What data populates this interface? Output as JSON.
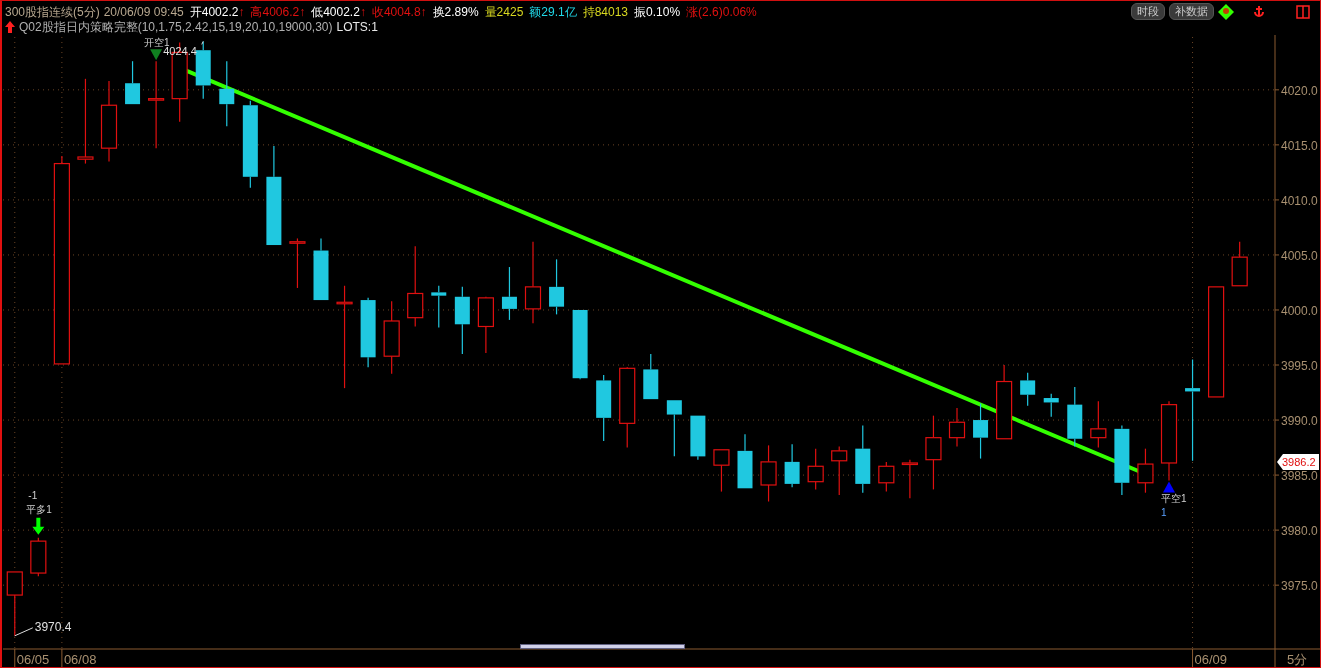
{
  "header": {
    "title": "300股指连续(5分)",
    "datetime": "20/06/09 09:45",
    "quotes": [
      {
        "label": "开",
        "value": "4002.2",
        "arrow": "↑",
        "color": "#ffffff"
      },
      {
        "label": "高",
        "value": "4006.2",
        "arrow": "↑",
        "color": "#e01010"
      },
      {
        "label": "低",
        "value": "4002.2",
        "arrow": "↑",
        "color": "#ffffff"
      },
      {
        "label": "收",
        "value": "4004.8",
        "arrow": "↑",
        "color": "#e01010"
      },
      {
        "label": "换",
        "value": "2.89%",
        "color": "#ffffff"
      },
      {
        "label": "量",
        "value": "2425",
        "color": "#d8d820"
      },
      {
        "label": "额",
        "value": "29.1亿",
        "color": "#20d8e8"
      },
      {
        "label": "持",
        "value": "84013",
        "color": "#d8d820"
      },
      {
        "label": "振",
        "value": "0.10%",
        "color": "#ffffff"
      },
      {
        "label": "涨",
        "value": "(2.6)0.06%",
        "color": "#e01010"
      }
    ],
    "buttons": [
      "时段",
      "补数据"
    ]
  },
  "strategy": {
    "name": "Q02股指日内策略完整(10,1.75,2.42,15,19,20,10,19000,30)",
    "lots": "LOTS:1"
  },
  "price_chart": {
    "chart_data": {
      "type": "candlestick",
      "xlabel": "5分",
      "categories": [
        null,
        null,
        null,
        null,
        null,
        null,
        null,
        null,
        null,
        null,
        null,
        null,
        null,
        null,
        null,
        null,
        null,
        null,
        null,
        null,
        null,
        null,
        null,
        null,
        null,
        null,
        null,
        null,
        null,
        null,
        null,
        null,
        null,
        null,
        null,
        null,
        null,
        null,
        null,
        null,
        null,
        null,
        null,
        null,
        null,
        null,
        null,
        null,
        null,
        null,
        null,
        null,
        null
      ],
      "ylim": [
        3969.2,
        4024.8
      ],
      "grid": true,
      "yticks": [
        {
          "value": 4020,
          "label": "4020.0"
        },
        {
          "value": 4015,
          "label": "4015.0"
        },
        {
          "value": 4010,
          "label": "4010.0"
        },
        {
          "value": 4005,
          "label": "4005.0"
        },
        {
          "value": 4000,
          "label": "4000.0"
        },
        {
          "value": 3995,
          "label": "3995.0"
        },
        {
          "value": 3990,
          "label": "3990.0"
        },
        {
          "value": 3985,
          "label": "3985.0"
        },
        {
          "value": 3980,
          "label": "3980.0"
        },
        {
          "value": 3975,
          "label": "3975.0"
        }
      ],
      "ohlc": [
        [
          3974.1,
          3976.2,
          3970.4,
          3976.2
        ],
        [
          3976.1,
          3979.3,
          3975.8,
          3979.0
        ],
        [
          3995.1,
          4014.0,
          3995.1,
          4013.3
        ],
        [
          4013.7,
          4021.0,
          4013.3,
          4013.9
        ],
        [
          4014.7,
          4020.8,
          4013.5,
          4018.6
        ],
        [
          4020.6,
          4022.6,
          4018.7,
          4018.7
        ],
        [
          4019.1,
          4022.6,
          4014.7,
          4019.2
        ],
        [
          4019.2,
          4024.3,
          4017.1,
          4023.4
        ],
        [
          4023.6,
          4024.4,
          4019.2,
          4020.4
        ],
        [
          4020.1,
          4022.6,
          4016.7,
          4018.7
        ],
        [
          4018.6,
          4019.0,
          4011.1,
          4012.1
        ],
        [
          4012.1,
          4014.9,
          4005.9,
          4005.9
        ],
        [
          4006.1,
          4006.5,
          4002.0,
          4006.2
        ],
        [
          4005.4,
          4006.5,
          4000.9,
          4000.9
        ],
        [
          4000.6,
          4002.2,
          3992.9,
          4000.7
        ],
        [
          4000.9,
          4001.1,
          3994.8,
          3995.7
        ],
        [
          3995.8,
          4000.8,
          3994.2,
          3999.0
        ],
        [
          3999.3,
          4005.8,
          3998.5,
          4001.5
        ],
        [
          4001.6,
          4002.2,
          3998.4,
          4001.3
        ],
        [
          4001.2,
          4002.1,
          3996.0,
          3998.7
        ],
        [
          3998.5,
          4001.2,
          3996.1,
          4001.1
        ],
        [
          4001.2,
          4003.9,
          3999.1,
          4000.1
        ],
        [
          4000.1,
          4006.2,
          3998.8,
          4002.1
        ],
        [
          4002.1,
          4004.6,
          3999.6,
          4000.3
        ],
        [
          4000.0,
          4000.0,
          3993.7,
          3993.8
        ],
        [
          3993.6,
          3994.1,
          3988.1,
          3990.2
        ],
        [
          3989.7,
          3994.8,
          3987.5,
          3994.7
        ],
        [
          3994.6,
          3996.0,
          3991.9,
          3991.9
        ],
        [
          3991.8,
          3991.8,
          3986.7,
          3990.5
        ],
        [
          3990.4,
          3990.4,
          3986.4,
          3986.7
        ],
        [
          3985.9,
          3987.3,
          3983.5,
          3987.3
        ],
        [
          3987.2,
          3988.7,
          3983.8,
          3983.8
        ],
        [
          3984.1,
          3987.7,
          3982.6,
          3986.2
        ],
        [
          3986.2,
          3987.8,
          3983.9,
          3984.2
        ],
        [
          3984.4,
          3987.4,
          3983.7,
          3985.8
        ],
        [
          3986.3,
          3987.6,
          3983.2,
          3987.2
        ],
        [
          3987.4,
          3989.5,
          3983.4,
          3984.2
        ],
        [
          3984.3,
          3986.2,
          3983.5,
          3985.8
        ],
        [
          3986.0,
          3986.4,
          3982.9,
          3986.1
        ],
        [
          3986.4,
          3990.4,
          3983.7,
          3988.4
        ],
        [
          3988.4,
          3991.1,
          3987.6,
          3989.8
        ],
        [
          3990.0,
          3991.5,
          3986.5,
          3988.4
        ],
        [
          3988.3,
          3995.0,
          3988.3,
          3993.5
        ],
        [
          3993.6,
          3994.3,
          3991.3,
          3992.3
        ],
        [
          3992.0,
          3992.4,
          3990.3,
          3991.6
        ],
        [
          3991.4,
          3993.0,
          3987.6,
          3988.3
        ],
        [
          3988.4,
          3991.7,
          3987.5,
          3989.2
        ],
        [
          3989.2,
          3989.5,
          3983.2,
          3984.3
        ],
        [
          3984.3,
          3987.4,
          3983.4,
          3986.0
        ],
        [
          3986.1,
          3991.7,
          3984.5,
          3991.4
        ],
        [
          3992.9,
          3995.5,
          3986.3,
          3992.6
        ],
        [
          3992.1,
          4002.1,
          3992.1,
          4002.1
        ],
        [
          4002.2,
          4006.2,
          4002.2,
          4004.8
        ]
      ]
    },
    "high_label": "4024.4",
    "low_label": "3970.4",
    "date_labels": [
      "06/05",
      "06/08",
      "06/09"
    ],
    "price_tag": "3986.2",
    "signals": [
      {
        "kind": "triangle-down",
        "label": "开空1"
      },
      {
        "kind": "arrow-down",
        "label": "平多1",
        "quantity": "-1"
      },
      {
        "kind": "triangle-up",
        "label": "平空1",
        "quantity": "1"
      }
    ]
  }
}
